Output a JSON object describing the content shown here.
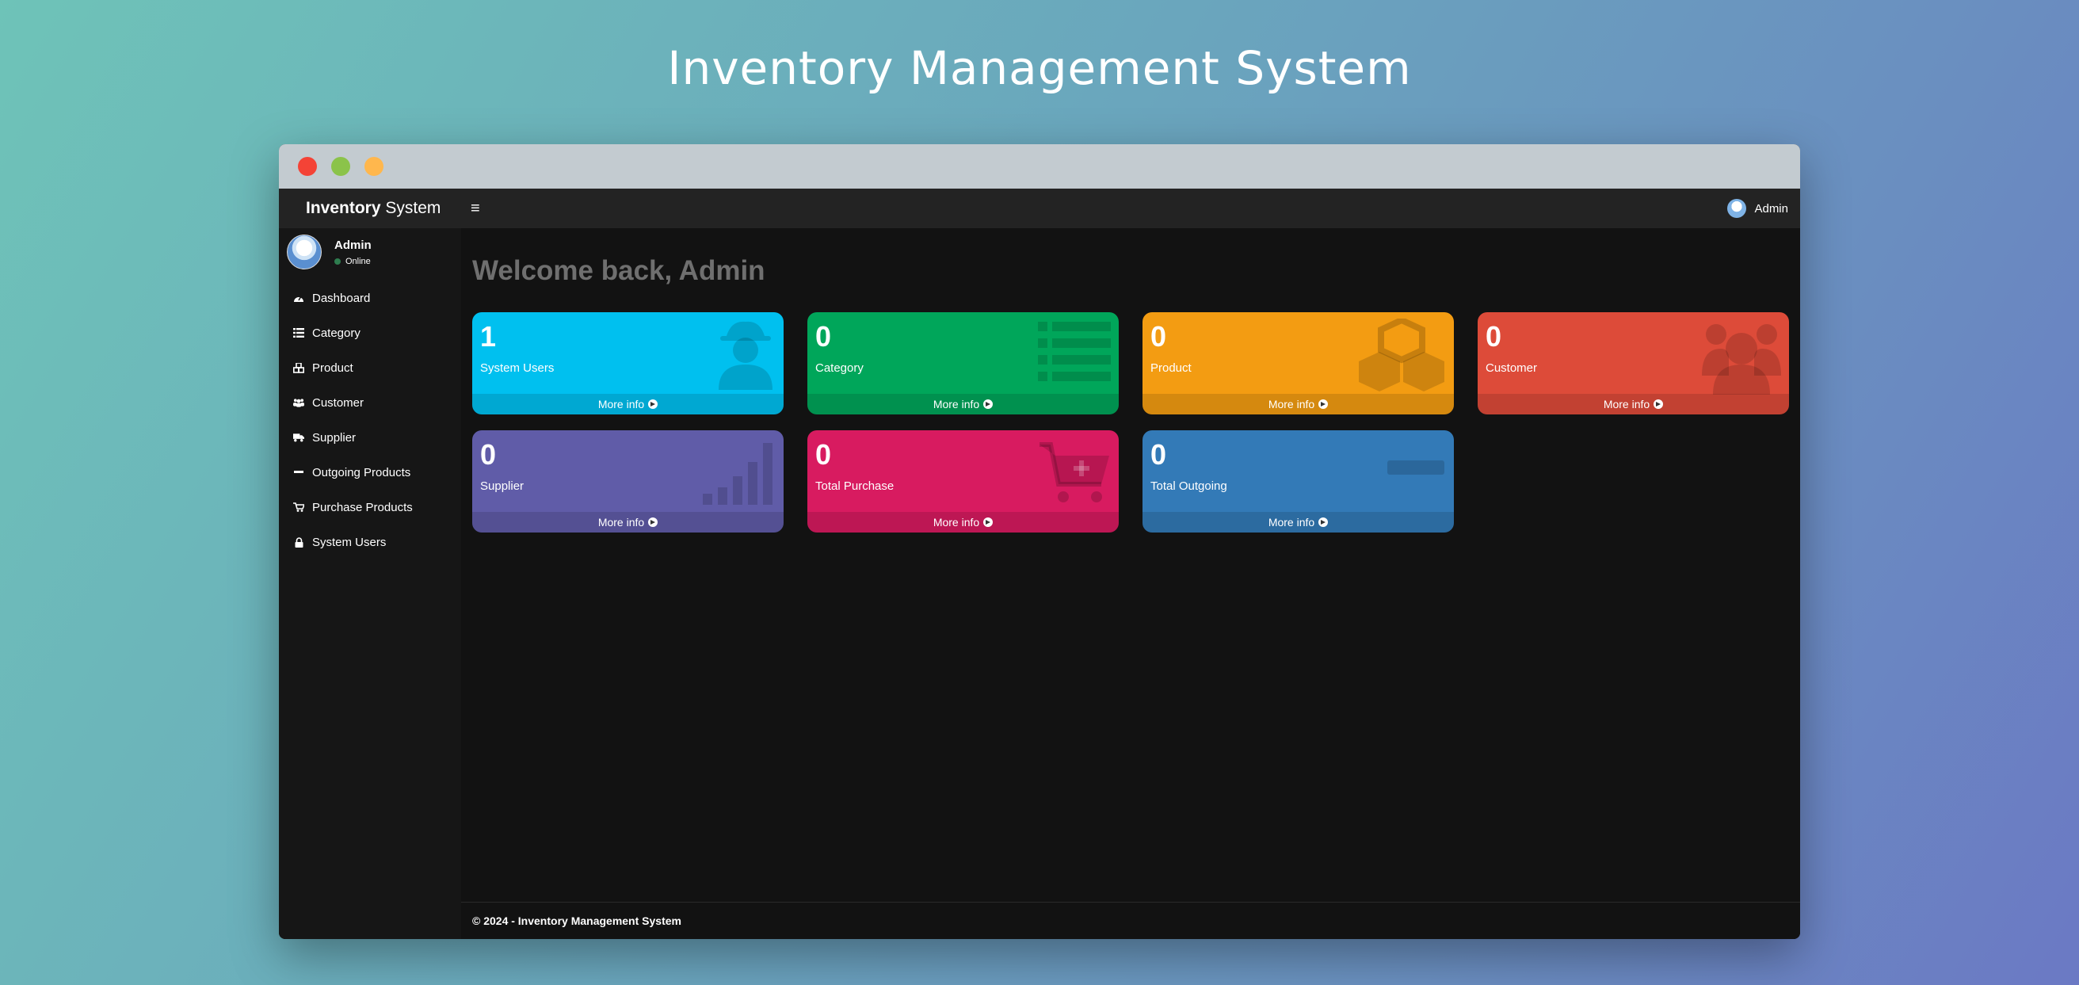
{
  "page": {
    "heading": "Inventory Management System"
  },
  "topbar": {
    "brand_bold": "Inventory",
    "brand_rest": " System",
    "menu_toggle": "≡",
    "user_name": "Admin"
  },
  "sidebar": {
    "user": {
      "name": "Admin",
      "status": "Online"
    },
    "items": [
      {
        "label": "Dashboard",
        "icon": "dashboard-icon"
      },
      {
        "label": "Category",
        "icon": "list-icon"
      },
      {
        "label": "Product",
        "icon": "cubes-icon"
      },
      {
        "label": "Customer",
        "icon": "users-icon"
      },
      {
        "label": "Supplier",
        "icon": "truck-icon"
      },
      {
        "label": "Outgoing Products",
        "icon": "minus-icon"
      },
      {
        "label": "Purchase Products",
        "icon": "cart-icon"
      },
      {
        "label": "System Users",
        "icon": "lock-icon"
      }
    ]
  },
  "main": {
    "welcome": "Welcome back, Admin",
    "cards": [
      {
        "value": "1",
        "label": "System Users",
        "more": "More info",
        "color": "#00c0ef",
        "icon": "user-secret-icon"
      },
      {
        "value": "0",
        "label": "Category",
        "more": "More info",
        "color": "#00a65a",
        "icon": "list-icon"
      },
      {
        "value": "0",
        "label": "Product",
        "more": "More info",
        "color": "#f39c12",
        "icon": "cubes-icon"
      },
      {
        "value": "0",
        "label": "Customer",
        "more": "More info",
        "color": "#dd4b39",
        "icon": "users-icon"
      },
      {
        "value": "0",
        "label": "Supplier",
        "more": "More info",
        "color": "#605ca8",
        "icon": "bar-chart-icon"
      },
      {
        "value": "0",
        "label": "Total Purchase",
        "more": "More info",
        "color": "#d81b60",
        "icon": "cart-plus-icon"
      },
      {
        "value": "0",
        "label": "Total Outgoing",
        "more": "More info",
        "color": "#337ab7",
        "icon": "minus-icon"
      }
    ]
  },
  "footer": {
    "text": "© 2024 - Inventory Management System"
  }
}
